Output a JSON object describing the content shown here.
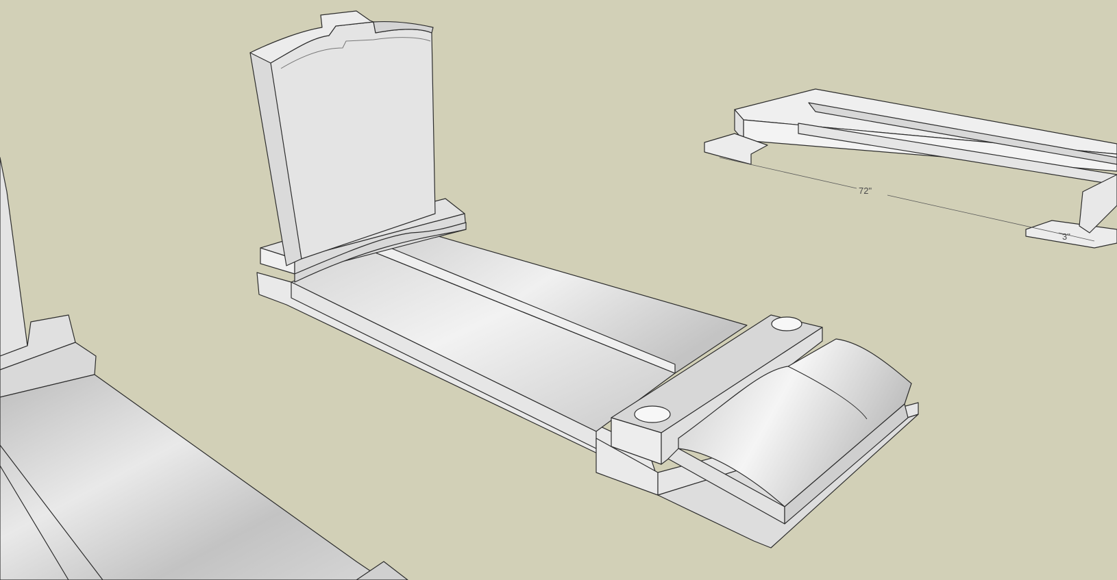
{
  "viewport": {
    "background_color": "#d2d0b7"
  },
  "models": {
    "left_partial": {
      "label": ""
    },
    "center_monument": {
      "label": ""
    },
    "right_frame": {
      "label": ""
    }
  },
  "dimensions": {
    "length_label": "72\"",
    "height_label": "3\""
  },
  "colors": {
    "stone_light": "#e7e7e7",
    "stone_mid": "#d8d8d8",
    "stone_dark": "#bdbdbd",
    "edge": "#2c2c2c"
  }
}
